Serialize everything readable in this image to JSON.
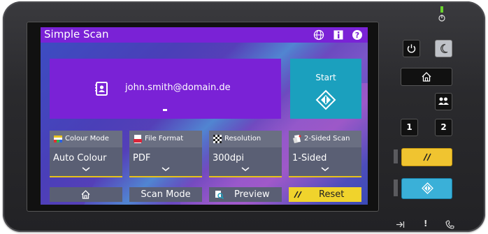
{
  "app": {
    "title": "Simple Scan"
  },
  "user": {
    "email": "john.smith@domain.de"
  },
  "start": {
    "label": "Start"
  },
  "settings": [
    {
      "label": "Colour Mode",
      "value": "Auto Colour",
      "icon": "colour-mode-icon"
    },
    {
      "label": "File Format",
      "value": "PDF",
      "icon": "pdf-file-icon"
    },
    {
      "label": "Resolution",
      "value": "300dpi",
      "icon": "resolution-icon"
    },
    {
      "label": "2-Sided Scan",
      "value": "1-Sided",
      "icon": "duplex-scan-icon"
    }
  ],
  "bottom_buttons": {
    "scan_mode": "Scan Mode",
    "preview": "Preview",
    "reset": "Reset"
  },
  "hardware": {
    "key_1": "1",
    "key_2": "2",
    "status_alert": "!"
  },
  "colors": {
    "accent_purple": "#7a22d6",
    "start_teal": "#1ba0be",
    "reset_yellow": "#f0d32c",
    "panel_grey": "#5a5f74"
  }
}
